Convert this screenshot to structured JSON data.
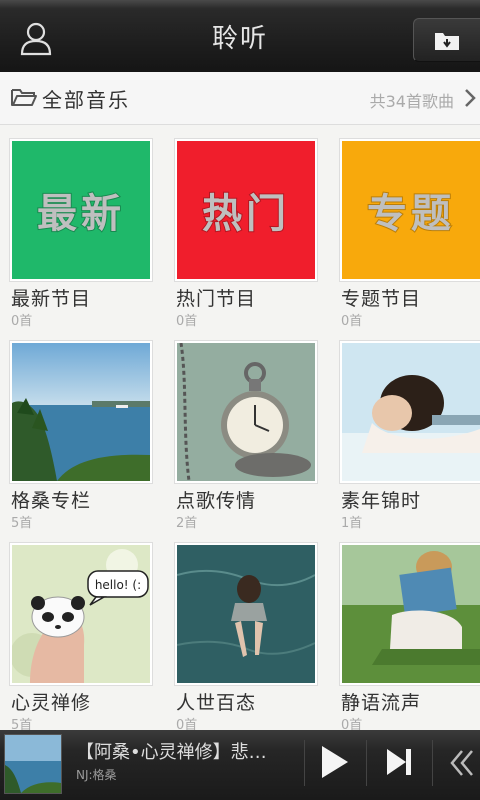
{
  "header": {
    "title": "聆听",
    "user_icon": "user-icon",
    "right_icon": "download-folder-icon"
  },
  "category": {
    "label": "全部音乐",
    "count": "共34首歌曲",
    "folder_icon": "folder-icon",
    "chevron_icon": "chevron-right-icon"
  },
  "tiles": [
    {
      "name": "最新节目",
      "count": "0首",
      "block_text": "最新",
      "color": "#1fb86a"
    },
    {
      "name": "热门节目",
      "count": "0首",
      "block_text": "热门",
      "color": "#f01e2c"
    },
    {
      "name": "专题节目",
      "count": "0首",
      "block_text": "专题",
      "color": "#f8a90c"
    },
    {
      "name": "格桑专栏",
      "count": "5首"
    },
    {
      "name": "点歌传情",
      "count": "2首"
    },
    {
      "name": "素年锦时",
      "count": "1首"
    },
    {
      "name": "心灵禅修",
      "count": "5首",
      "bubble_text": "hello! (:"
    },
    {
      "name": "人世百态",
      "count": "0首"
    },
    {
      "name": "静语流声",
      "count": "0首"
    }
  ],
  "player": {
    "song": "【阿桑•心灵禅修】悲…",
    "nj": "NJ:格桑",
    "play_icon": "play-icon",
    "next_icon": "next-track-icon",
    "back_icon": "double-chevron-left-icon"
  }
}
